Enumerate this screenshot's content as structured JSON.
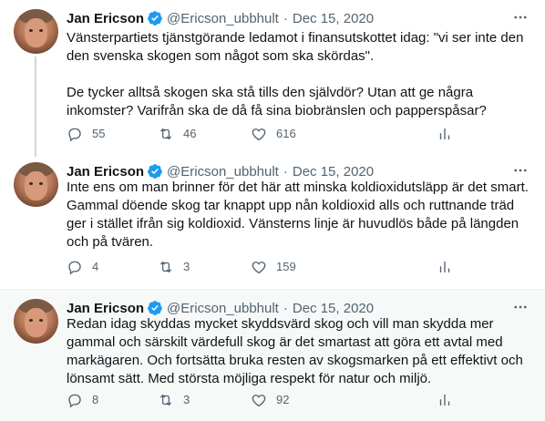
{
  "colors": {
    "accent": "#1d9bf0",
    "muted": "#536471",
    "text": "#0f1419"
  },
  "tweets": [
    {
      "name": "Jan Ericson",
      "handle": "@Ericson_ubbhult",
      "separator": "·",
      "date": "Dec 15, 2020",
      "text": "Vänsterpartiets tjänstgörande ledamot i finansutskottet idag: \"vi ser inte den den svenska skogen som något som ska skördas\".\n\nDe tycker alltså skogen ska stå tills den självdör? Utan att ge några inkomster? Varifrån ska de då få sina biobränslen och papperspåsar?",
      "replies": "55",
      "retweets": "46",
      "likes": "616"
    },
    {
      "name": "Jan Ericson",
      "handle": "@Ericson_ubbhult",
      "separator": "·",
      "date": "Dec 15, 2020",
      "text": "Inte ens om man brinner för det här att minska koldioxidutsläpp är det smart. Gammal döende skog tar knappt upp nån koldioxid alls och ruttnande träd ger i stället ifrån sig koldioxid. Vänsterns linje är huvudlös både på längden och på tvären.",
      "replies": "4",
      "retweets": "3",
      "likes": "159"
    },
    {
      "name": "Jan Ericson",
      "handle": "@Ericson_ubbhult",
      "separator": "·",
      "date": "Dec 15, 2020",
      "text": "Redan idag skyddas mycket skyddsvärd skog och vill man skydda mer gammal och särskilt värdefull skog är det smartast att göra ett avtal med markägaren. Och fortsätta bruka resten av skogsmarken på ett effektivt och lönsamt sätt. Med största möjliga respekt för natur och miljö.",
      "replies": "8",
      "retweets": "3",
      "likes": "92"
    }
  ]
}
